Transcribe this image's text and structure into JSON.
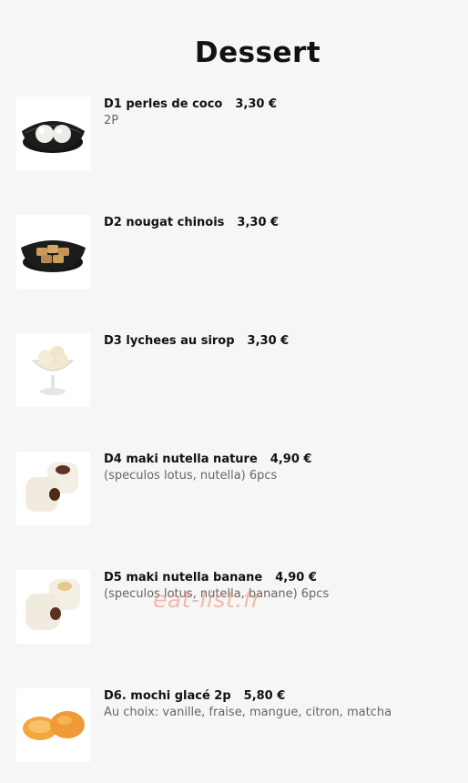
{
  "page": {
    "title": "Dessert",
    "watermark": "eat-list.fr"
  },
  "items": [
    {
      "code_name": "D1 perles de coco",
      "price": "3,30 €",
      "description": "2P",
      "image": "coconut-pearls-photo"
    },
    {
      "code_name": "D2 nougat chinois",
      "price": "3,30 €",
      "description": "",
      "image": "chinese-nougat-photo"
    },
    {
      "code_name": "D3 lychees au sirop",
      "price": "3,30 €",
      "description": "",
      "image": "lychee-syrup-photo"
    },
    {
      "code_name": "D4 maki nutella nature",
      "price": "4,90 €",
      "description": "(speculos lotus, nutella) 6pcs",
      "image": "maki-nutella-photo"
    },
    {
      "code_name": "D5 maki nutella banane",
      "price": "4,90 €",
      "description": "(speculos lotus, nutella, banane) 6pcs",
      "image": "maki-nutella-banana-photo"
    },
    {
      "code_name": "D6. mochi glacé 2p",
      "price": "5,80 €",
      "description": "Au choix: vanille, fraise, mangue, citron, matcha",
      "image": "mochi-photo"
    }
  ]
}
